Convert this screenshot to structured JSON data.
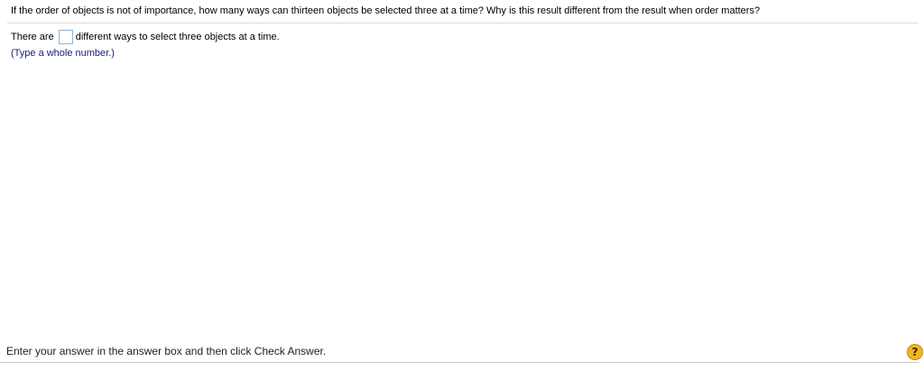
{
  "question": {
    "text": "If the order of objects is not of importance, how many ways can thirteen objects be selected three at a time? Why is this result different from the result when order matters?"
  },
  "answer": {
    "prefix": "There are",
    "value": "",
    "suffix": "different ways to select three objects at a time.",
    "hint": "(Type a whole number.)"
  },
  "footer": {
    "instruction": "Enter your answer in the answer box and then click Check Answer.",
    "help_icon": "question-mark-icon",
    "help_glyph": "?"
  },
  "colors": {
    "hint_text": "#1a237e",
    "help_button": "#f2b51f",
    "answer_box_border": "#8fb3d9"
  }
}
